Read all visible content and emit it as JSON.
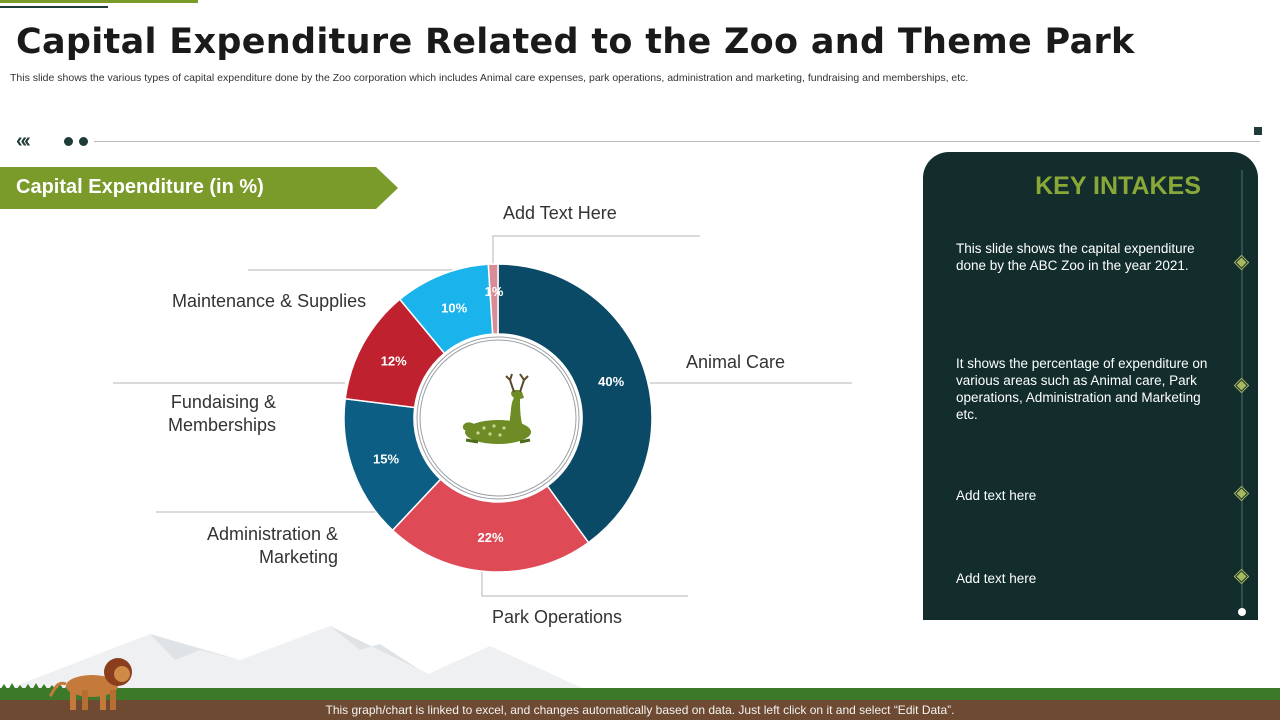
{
  "header": {
    "title": "Capital Expenditure Related to the Zoo and Theme Park",
    "subtitle": "This slide shows the various types of capital expenditure done by the Zoo corporation which includes Animal care expenses, park operations, administration and marketing, fundraising and memberships, etc."
  },
  "nav": {
    "arrows": "«‹"
  },
  "banner": {
    "label": "Capital Expenditure (in %)"
  },
  "chart_data": {
    "type": "donut",
    "title": "Capital Expenditure (in %)",
    "slices": [
      {
        "name": "Animal Care",
        "value": 40,
        "label": "40%",
        "color": "#0b4a66"
      },
      {
        "name": "Park Operations",
        "value": 22,
        "label": "22%",
        "color": "#de4b57"
      },
      {
        "name": "Administration & Marketing",
        "value": 15,
        "label": "15%",
        "color": "#0d5e84"
      },
      {
        "name": "Fundaising & Memberships",
        "value": 12,
        "label": "12%",
        "color": "#c0212e"
      },
      {
        "name": "Maintenance & Supplies",
        "value": 10,
        "label": "10%",
        "color": "#1ab3ec"
      },
      {
        "name": "Add Text Here",
        "value": 1,
        "label": "1%",
        "color": "#d98c96"
      }
    ],
    "center_icon": "deer-icon"
  },
  "labels": {
    "add_text": "Add Text Here",
    "maintenance": "Maintenance & Supplies",
    "animal_care": "Animal Care",
    "fundraising_line1": "Fundaising &",
    "fundraising_line2": "Memberships",
    "admin_line1": "Administration &",
    "admin_line2": "Marketing",
    "park_operations": "Park Operations"
  },
  "panel": {
    "title": "KEY INTAKES",
    "items": [
      {
        "text": "This slide shows the capital expenditure done by the ABC Zoo in the year 2021."
      },
      {
        "text": "It shows the percentage of expenditure on various areas such as Animal care, Park operations, Administration and Marketing etc."
      },
      {
        "text": "Add text here"
      },
      {
        "text": "Add text here"
      }
    ]
  },
  "footer": {
    "note": "This graph/chart is linked to excel, and changes automatically based on data. Just left click on it and select “Edit Data”."
  },
  "colors": {
    "accent_green": "#7a9a2a",
    "panel_bg": "#122d2c",
    "panel_title": "#8aa838"
  },
  "icons": {
    "center": "deer-icon",
    "scenery": "lion-icon"
  }
}
